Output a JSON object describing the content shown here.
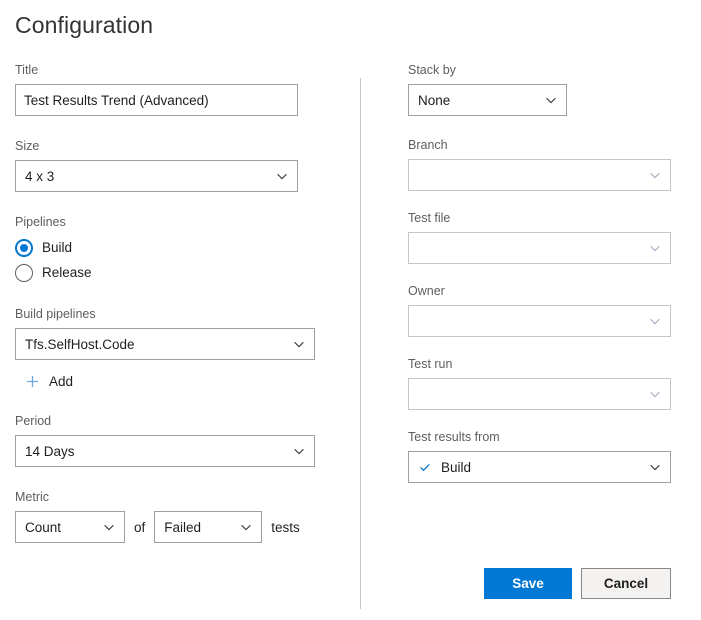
{
  "page": {
    "title": "Configuration"
  },
  "colors": {
    "accent": "#0078d4",
    "label": "#605e5c",
    "border": "#a19f9d",
    "border_muted": "#c8c6c4",
    "text": "#201f1e",
    "cancel_bg": "#f3f2f1",
    "plus": "#6fa8dc"
  },
  "left": {
    "title_field": {
      "label": "Title",
      "value": "Test Results Trend (Advanced)",
      "placeholder": ""
    },
    "size_field": {
      "label": "Size",
      "value": "4 x 3"
    },
    "pipelines": {
      "label": "Pipelines",
      "options": [
        {
          "label": "Build",
          "checked": true
        },
        {
          "label": "Release",
          "checked": false
        }
      ]
    },
    "build_pipelines": {
      "label": "Build pipelines",
      "value": "Tfs.SelfHost.Code",
      "add_label": "Add"
    },
    "period": {
      "label": "Period",
      "value": "14 Days"
    },
    "metric": {
      "label": "Metric",
      "aggregate_value": "Count",
      "of_word": "of",
      "outcome_value": "Failed",
      "tests_word": "tests"
    }
  },
  "right": {
    "stack_by": {
      "label": "Stack by",
      "value": "None"
    },
    "branch": {
      "label": "Branch",
      "value": ""
    },
    "test_file": {
      "label": "Test file",
      "value": ""
    },
    "owner": {
      "label": "Owner",
      "value": ""
    },
    "test_run": {
      "label": "Test run",
      "value": ""
    },
    "test_results_from": {
      "label": "Test results from",
      "value": "Build"
    },
    "buttons": {
      "save": "Save",
      "cancel": "Cancel"
    }
  }
}
